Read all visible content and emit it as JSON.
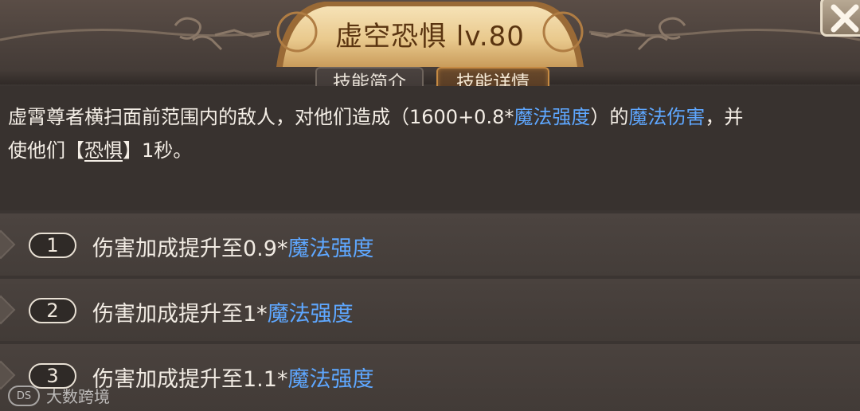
{
  "header": {
    "title": "虚空恐惧 lv.80",
    "close_icon": "close-icon"
  },
  "tabs": [
    {
      "label": "技能简介",
      "active": false
    },
    {
      "label": "技能详情",
      "active": true
    }
  ],
  "description": {
    "part1": "虚霄尊者横扫面前范围内的敌人，对他们造成（1600+0.8*",
    "kw1": "魔法强度",
    "part2": "）的",
    "kw2": "魔法伤害",
    "part3": "，并",
    "line2_part1": "使他们【",
    "kw3": "恐惧",
    "line2_part2": "】1秒。"
  },
  "upgrades": [
    {
      "number": "1",
      "text": "伤害加成提升至0.9*",
      "keyword": "魔法强度"
    },
    {
      "number": "2",
      "text": "伤害加成提升至1*",
      "keyword": "魔法强度"
    },
    {
      "number": "3",
      "text": "伤害加成提升至1.1*",
      "keyword": "魔法强度"
    }
  ],
  "watermark": {
    "logo": "DS",
    "text": "大数跨境"
  },
  "colors": {
    "keyword": "#5ea7ff",
    "background": "#3b3532",
    "title_text": "#5a3410",
    "active_tab_border": "#c58a43"
  }
}
